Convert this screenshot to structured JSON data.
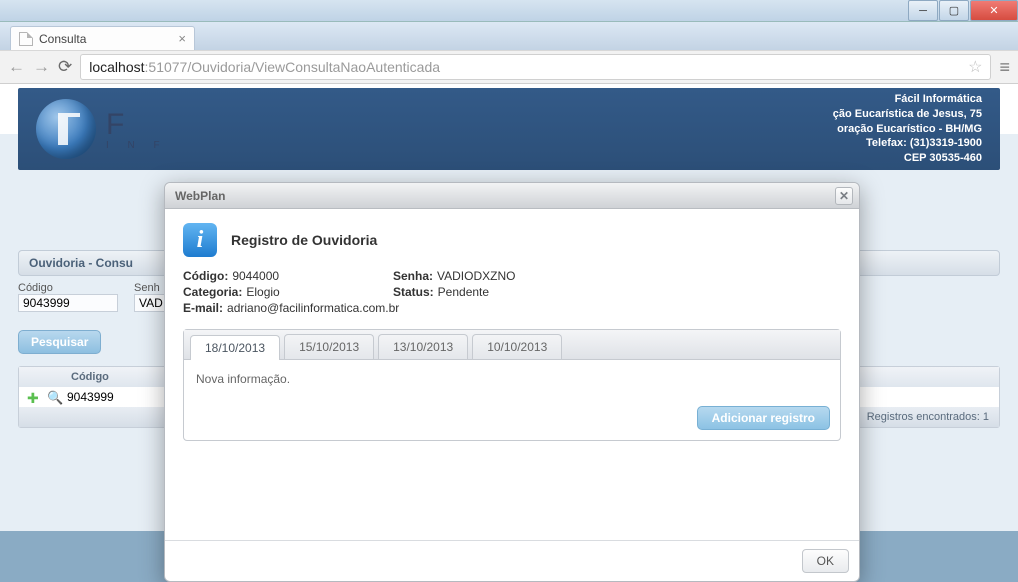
{
  "browser": {
    "tab_title": "Consulta",
    "url_host": "localhost",
    "url_port": ":51077",
    "url_path": "/Ouvidoria/ViewConsultaNaoAutenticada"
  },
  "header": {
    "brand_line1": "F",
    "brand_sub": "I  N  F",
    "addr": {
      "l1": "Fácil Informática",
      "l2": "ção Eucarística de Jesus, 75",
      "l3": "oração Eucarístico - BH/MG",
      "l4": "Telefax: (31)3319-1900",
      "l5": "CEP 30535-460"
    }
  },
  "page": {
    "section_title": "Ouvidoria - Consu",
    "filters": {
      "codigo_label": "Código",
      "codigo_value": "9043999",
      "senha_label": "Senh",
      "senha_value": "VAD"
    },
    "search_btn": "Pesquisar",
    "grid": {
      "col_codigo": "Código",
      "row_codigo": "9043999",
      "footer": "Registros encontrados: 1"
    }
  },
  "modal": {
    "title": "WebPlan",
    "heading": "Registro de Ouvidoria",
    "fields": {
      "codigo_label": "Código:",
      "codigo_value": "9044000",
      "categoria_label": "Categoria:",
      "categoria_value": "Elogio",
      "email_label": "E-mail:",
      "email_value": "adriano@facilinformatica.com.br",
      "senha_label": "Senha:",
      "senha_value": "VADIODXZNO",
      "status_label": "Status:",
      "status_value": "Pendente"
    },
    "tabs": [
      "18/10/2013",
      "15/10/2013",
      "13/10/2013",
      "10/10/2013"
    ],
    "tab_content": "Nova informação.",
    "add_btn": "Adicionar registro",
    "ok_btn": "OK"
  }
}
